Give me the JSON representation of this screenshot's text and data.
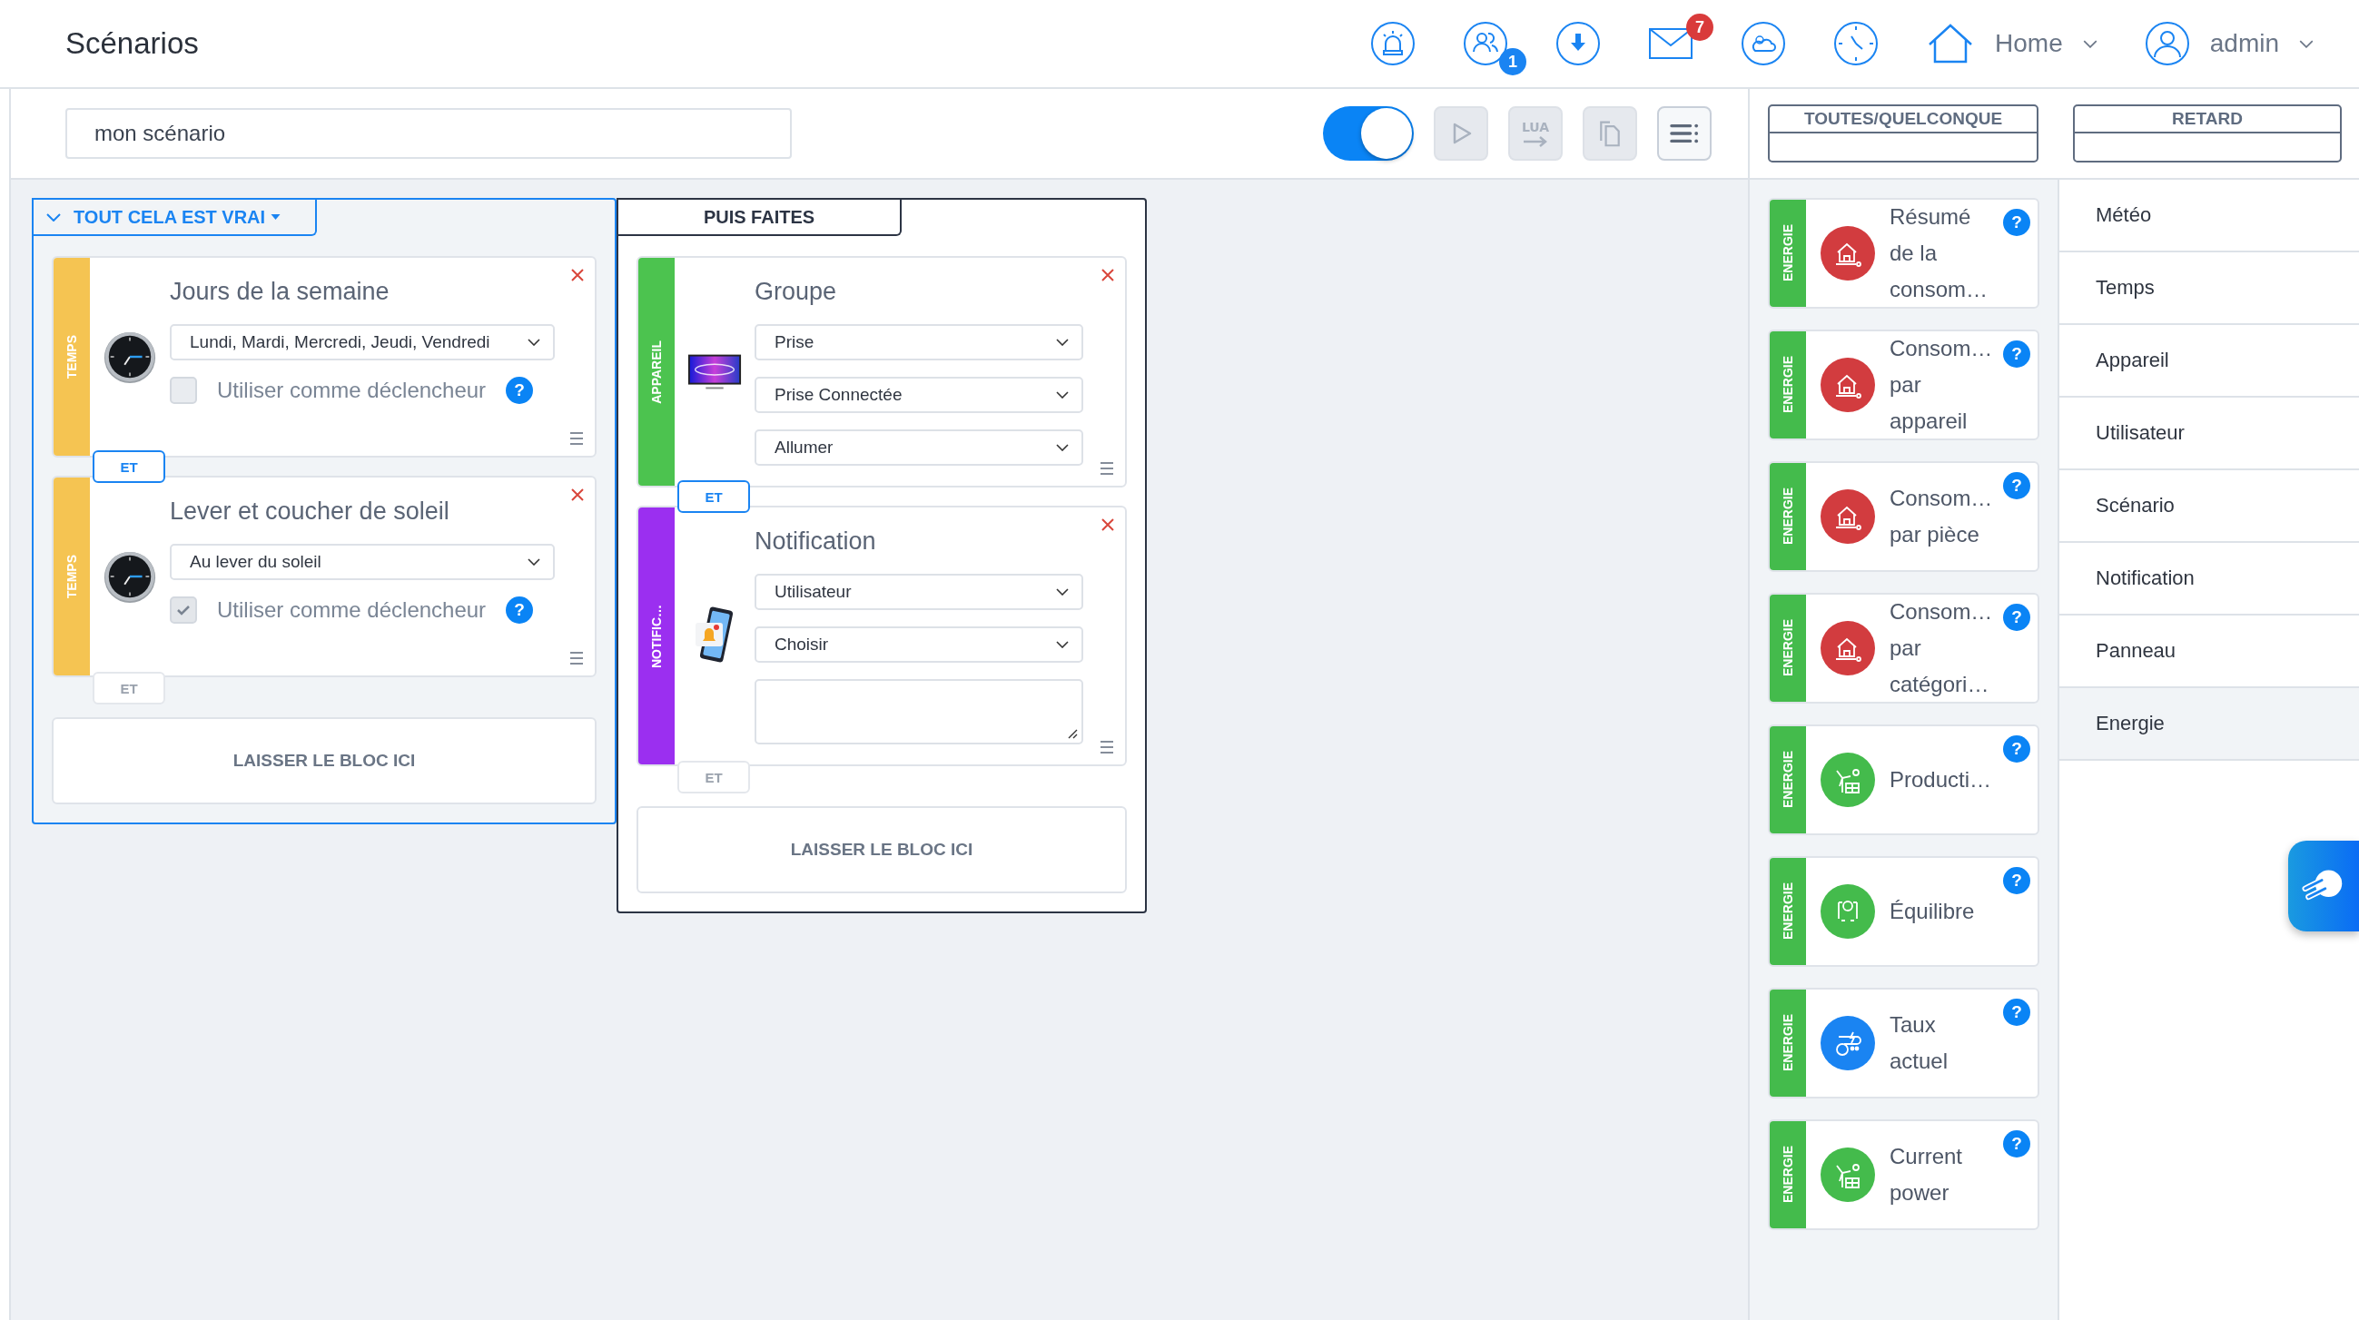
{
  "header": {
    "title": "Scénarios",
    "users_badge": "1",
    "mail_badge": "7",
    "home_label": "Home",
    "user_label": "admin"
  },
  "toolbar": {
    "scenario_name": "mon scénario",
    "toggle": {
      "on": true
    },
    "buttons": [
      {
        "kind": "play",
        "disabled": true
      },
      {
        "kind": "lua",
        "label": "LUA",
        "disabled": true
      },
      {
        "kind": "copy",
        "disabled": true
      },
      {
        "kind": "menu",
        "disabled": false
      }
    ]
  },
  "templates": [
    {
      "label": "TOUTES/QUELCONQUE"
    },
    {
      "label": "RETARD"
    }
  ],
  "conditions": {
    "title": "TOUT CELA EST VRAI",
    "blocks": [
      {
        "category": "TEMPS",
        "color": "#f5c452",
        "kind": "clock",
        "title": "Jours de la semaine",
        "selects": [
          "Lundi, Mardi, Mercredi, Jeudi, Vendredi"
        ],
        "trigger": {
          "label": "Utiliser comme déclencheur",
          "checked": false,
          "help": "?"
        },
        "connector": {
          "label": "ET",
          "active": true
        }
      },
      {
        "category": "TEMPS",
        "color": "#f5c452",
        "kind": "clock",
        "title": "Lever et coucher de soleil",
        "selects": [
          "Au lever du soleil"
        ],
        "trigger": {
          "label": "Utiliser comme déclencheur",
          "checked": true,
          "help": "?"
        },
        "connector": {
          "label": "ET",
          "active": false
        }
      }
    ],
    "drop_zone": "LAISSER LE BLOC ICI"
  },
  "actions": {
    "title": "PUIS FAITES",
    "blocks": [
      {
        "category": "APPAREIL",
        "color": "#4cc34f",
        "kind": "monitor",
        "title": "Groupe",
        "selects": [
          "Prise",
          "Prise Connectée",
          "Allumer"
        ],
        "connector": {
          "label": "ET",
          "active": true
        }
      },
      {
        "category": "NOTIFIC…",
        "color": "#9b2ff0",
        "kind": "phone",
        "title": "Notification",
        "selects": [
          "Utilisateur",
          "Choisir"
        ],
        "message_field": true,
        "connector": {
          "label": "ET",
          "active": false
        }
      }
    ],
    "drop_zone": "LAISSER LE BLOC ICI"
  },
  "palette": [
    {
      "category": "ENERGIE",
      "kind": "house-plug",
      "label": "Résumé de la consom…",
      "help": "?"
    },
    {
      "category": "ENERGIE",
      "kind": "house-plug",
      "label": "Consom… par appareil",
      "help": "?"
    },
    {
      "category": "ENERGIE",
      "kind": "house-plug",
      "label": "Consom… par pièce",
      "help": "?"
    },
    {
      "category": "ENERGIE",
      "kind": "house-plug",
      "label": "Consom… par catégori…",
      "help": "?"
    },
    {
      "category": "ENERGIE",
      "kind": "wind-solar",
      "label": "Producti…",
      "help": "?"
    },
    {
      "category": "ENERGIE",
      "kind": "balance",
      "label": "Équilibre",
      "help": "?"
    },
    {
      "category": "ENERGIE",
      "kind": "tariff",
      "label": "Taux actuel",
      "help": "?"
    },
    {
      "category": "ENERGIE",
      "kind": "wind-solar",
      "label": "Current power",
      "help": "?"
    }
  ],
  "categories": [
    {
      "label": "Météo",
      "selected": false
    },
    {
      "label": "Temps",
      "selected": false
    },
    {
      "label": "Appareil",
      "selected": false
    },
    {
      "label": "Utilisateur",
      "selected": false
    },
    {
      "label": "Scénario",
      "selected": false
    },
    {
      "label": "Notification",
      "selected": false
    },
    {
      "label": "Panneau",
      "selected": false
    },
    {
      "label": "Energie",
      "selected": true
    }
  ]
}
